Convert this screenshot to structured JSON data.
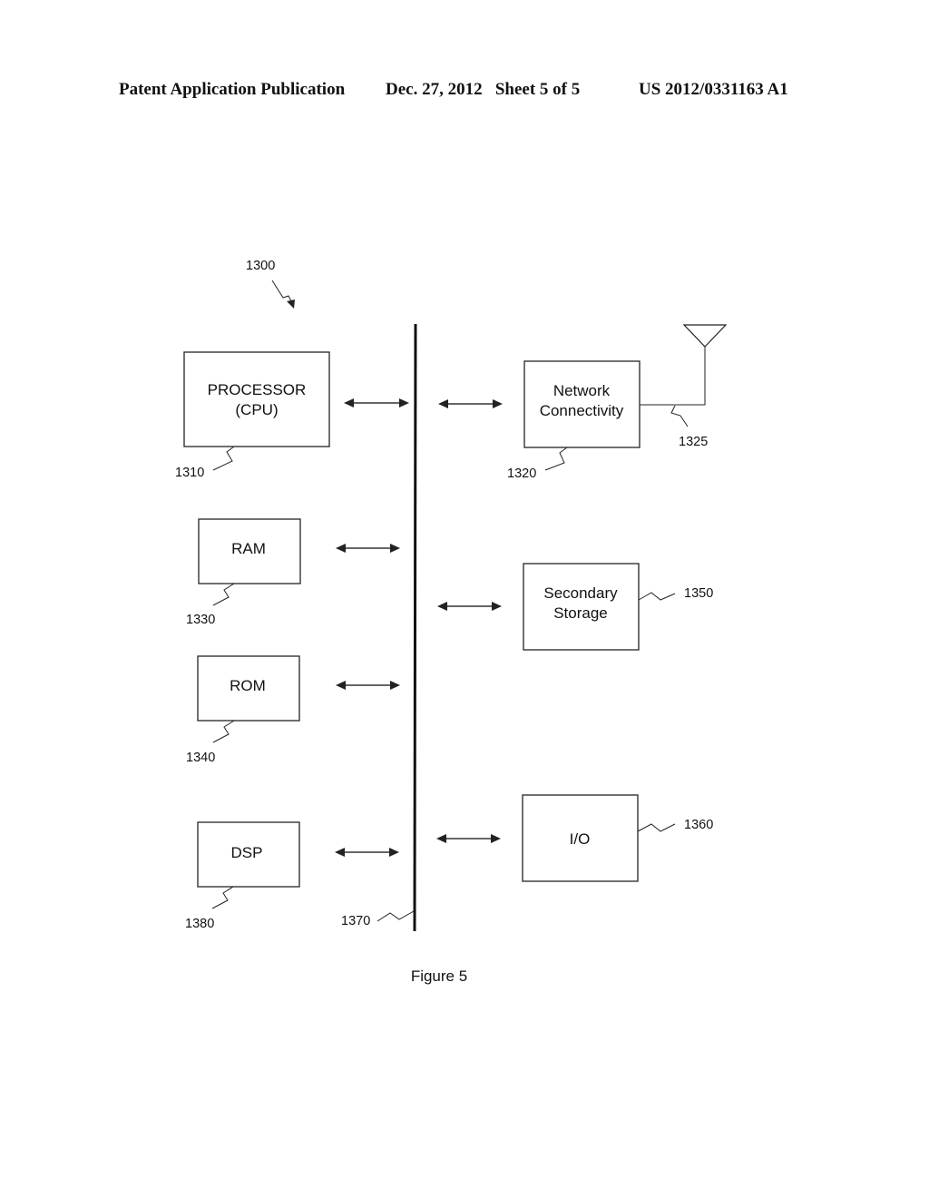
{
  "header": {
    "publication": "Patent Application Publication",
    "date_sheet": "Dec. 27, 2012   Sheet 5 of 5",
    "patent_number": "US 2012/0331163 A1"
  },
  "figure": {
    "caption": "Figure 5",
    "system_ref": "1300",
    "bus_ref": "1370",
    "antenna_ref": "1325",
    "blocks": {
      "processor": {
        "line1": "PROCESSOR",
        "line2": "(CPU)",
        "ref": "1310"
      },
      "network": {
        "line1": "Network",
        "line2": "Connectivity",
        "ref": "1320"
      },
      "ram": {
        "label": "RAM",
        "ref": "1330"
      },
      "rom": {
        "label": "ROM",
        "ref": "1340"
      },
      "storage": {
        "line1": "Secondary",
        "line2": "Storage",
        "ref": "1350"
      },
      "io": {
        "label": "I/O",
        "ref": "1360"
      },
      "dsp": {
        "label": "DSP",
        "ref": "1380"
      }
    }
  }
}
